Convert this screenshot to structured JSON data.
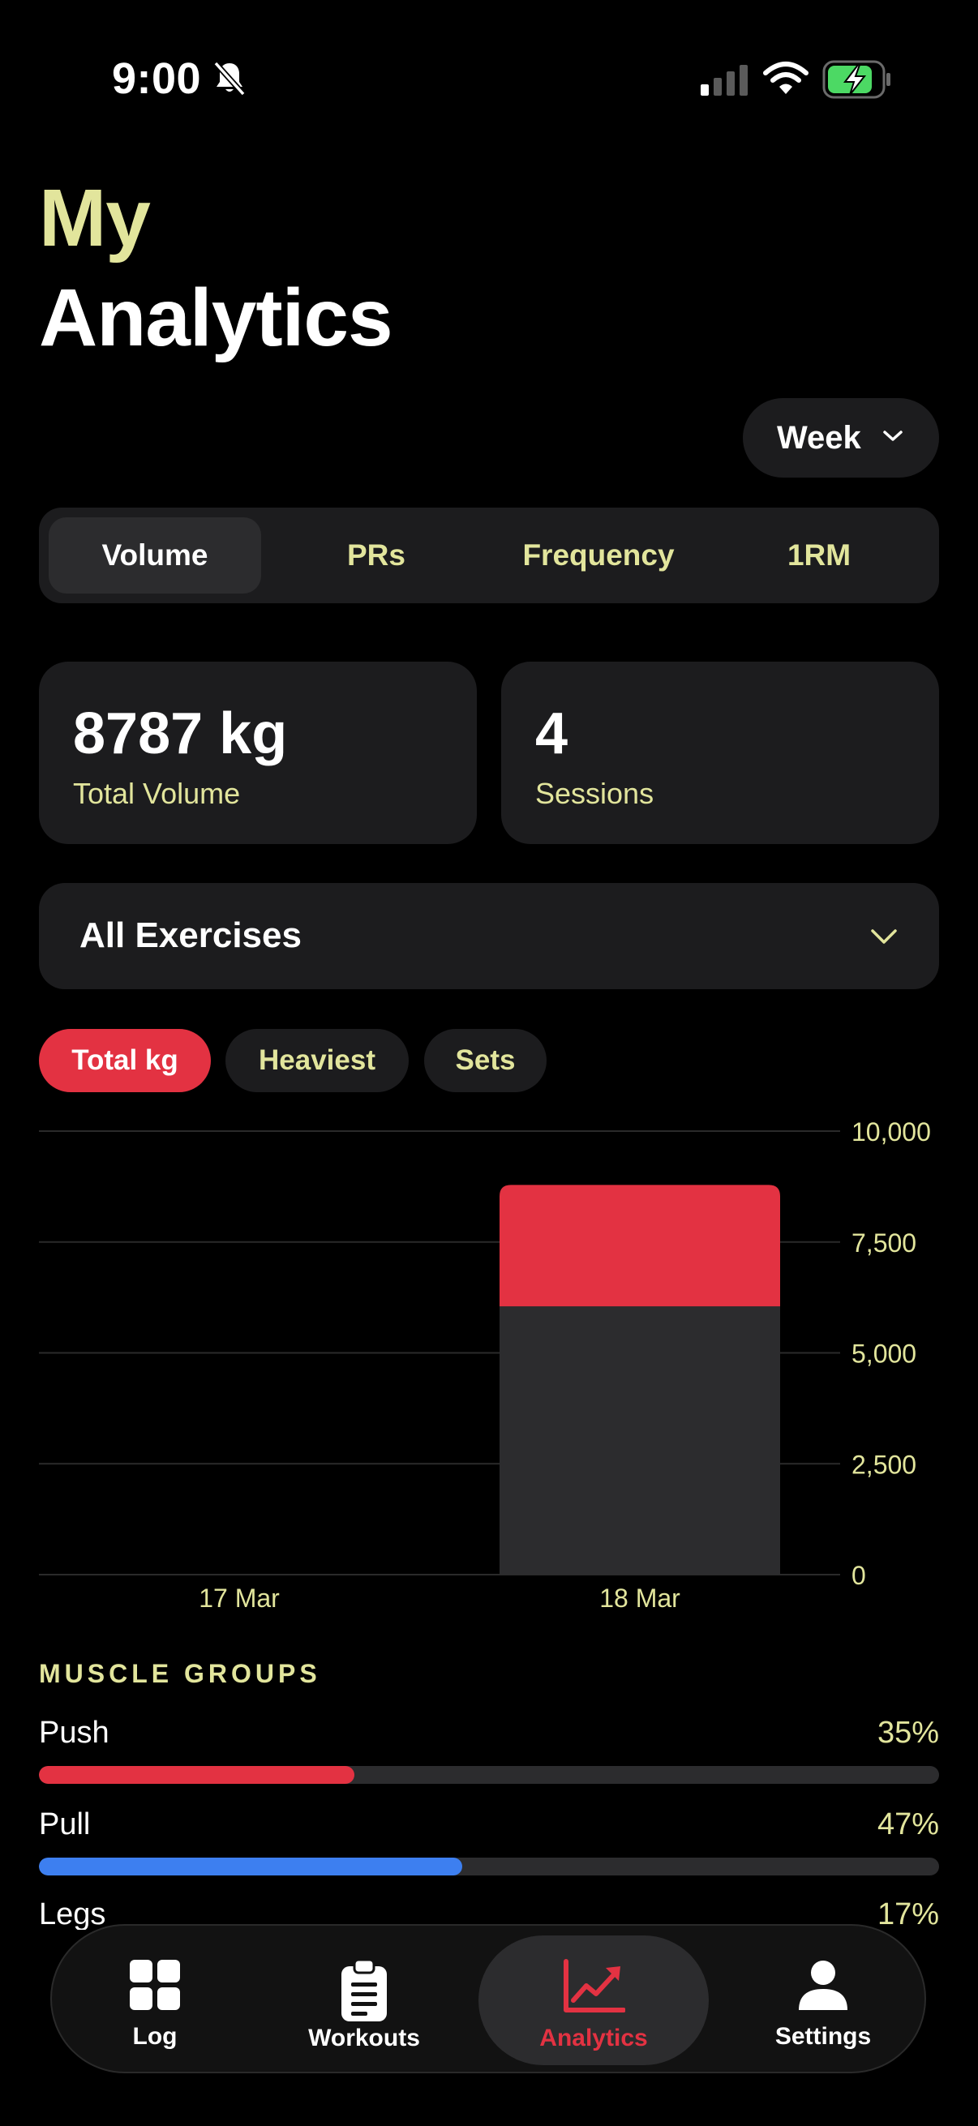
{
  "status_bar": {
    "time": "9:00",
    "icons": [
      "bell-slash-icon",
      "cellular-signal-icon",
      "wifi-icon",
      "battery-charging-icon"
    ]
  },
  "header": {
    "title_line1": "My",
    "title_line2": "Analytics"
  },
  "period_selector": {
    "value": "Week",
    "icon": "chevron-down-icon"
  },
  "tabs": [
    {
      "label": "Volume",
      "active": true
    },
    {
      "label": "PRs",
      "active": false
    },
    {
      "label": "Frequency",
      "active": false
    },
    {
      "label": "1RM",
      "active": false
    }
  ],
  "stats": [
    {
      "value": "8787 kg",
      "caption": "Total Volume"
    },
    {
      "value": "4",
      "caption": "Sessions"
    }
  ],
  "exercise_filter": {
    "value": "All Exercises",
    "icon": "chevron-down-icon"
  },
  "metric_chips": [
    {
      "label": "Total kg",
      "active": true
    },
    {
      "label": "Heaviest",
      "active": false
    },
    {
      "label": "Sets",
      "active": false
    }
  ],
  "chart_data": {
    "type": "bar",
    "stacked": true,
    "categories": [
      "17 Mar",
      "18 Mar"
    ],
    "series": [
      {
        "segment": "lower",
        "values": [
          0,
          6050
        ],
        "color": "#2c2c2e"
      },
      {
        "segment": "upper",
        "values": [
          0,
          2737
        ],
        "color": "#e33242"
      }
    ],
    "y_ticks": [
      "10,000",
      "7,500",
      "5,000",
      "2,500",
      "0"
    ],
    "ylim": [
      0,
      10000
    ],
    "y_axis_side": "right",
    "grid": true
  },
  "muscle_groups": {
    "title": "MUSCLE GROUPS",
    "items": [
      {
        "name": "Push",
        "percent_label": "35%",
        "fraction": 0.35,
        "color": "#e33242"
      },
      {
        "name": "Pull",
        "percent_label": "47%",
        "fraction": 0.47,
        "color": "#3d7ff0"
      },
      {
        "name": "Legs",
        "percent_label": "17%",
        "fraction": 0.17,
        "color": "#e2e59c"
      }
    ]
  },
  "tab_bar": [
    {
      "label": "Log",
      "icon": "grid-icon",
      "active": false
    },
    {
      "label": "Workouts",
      "icon": "clipboard-icon",
      "active": false
    },
    {
      "label": "Analytics",
      "icon": "chart-line-icon",
      "active": true
    },
    {
      "label": "Settings",
      "icon": "person-icon",
      "active": false
    }
  ],
  "colors": {
    "accent": "#e33242",
    "highlight_text": "#e2e59c",
    "card_bg": "#1c1c1e",
    "background": "#000000"
  }
}
